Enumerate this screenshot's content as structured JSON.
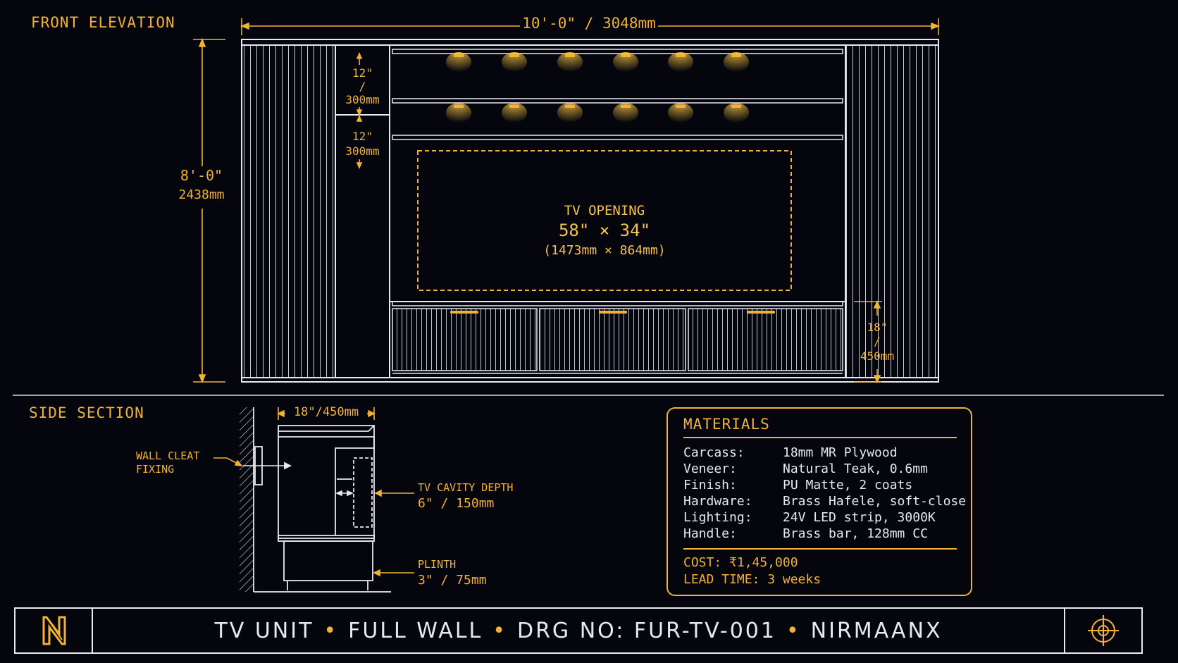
{
  "front_elevation": {
    "section_label": "FRONT ELEVATION",
    "width_dim": "10'-0\" / 3048mm",
    "height_dim_ft": "8'-0\"",
    "height_dim_mm": "2438mm",
    "shelf1_dim": [
      "12\"",
      "/",
      "300mm"
    ],
    "shelf2_dim": [
      "12\"",
      "300mm"
    ],
    "base_dim": [
      "18\"",
      "/",
      "450mm"
    ],
    "tv_opening": {
      "label": "TV OPENING",
      "size_in": "58\" × 34\"",
      "size_mm": "(1473mm × 864mm)"
    }
  },
  "side_section": {
    "section_label": "SIDE SECTION",
    "depth_dim": "18\"/450mm",
    "wall_cleat": [
      "WALL CLEAT",
      "FIXING"
    ],
    "tv_cavity_label": "TV CAVITY DEPTH",
    "tv_cavity_value": "6\" / 150mm",
    "plinth_label": "PLINTH",
    "plinth_value": "3\" / 75mm"
  },
  "materials": {
    "title": "MATERIALS",
    "rows": [
      {
        "key": "Carcass:",
        "value": "18mm MR Plywood"
      },
      {
        "key": "Veneer:",
        "value": "Natural Teak, 0.6mm"
      },
      {
        "key": "Finish:",
        "value": "PU Matte, 2 coats"
      },
      {
        "key": "Hardware:",
        "value": "Brass Hafele, soft-close"
      },
      {
        "key": "Lighting:",
        "value": "24V LED strip, 3000K"
      },
      {
        "key": "Handle:",
        "value": "Brass bar, 128mm CC"
      }
    ],
    "cost": "COST: ₹1,45,000",
    "lead_time": "LEAD TIME: 3 weeks"
  },
  "title_block": {
    "parts": [
      "TV UNIT",
      "FULL WALL",
      "DRG NO: FUR-TV-001",
      "NIRMAANX"
    ],
    "logo_icon": "nirmaanx-logo-icon",
    "target_icon": "crosshair-icon"
  },
  "colors": {
    "accent": "#f2b233",
    "line": "#e8e8ee",
    "background": "#05060d"
  }
}
